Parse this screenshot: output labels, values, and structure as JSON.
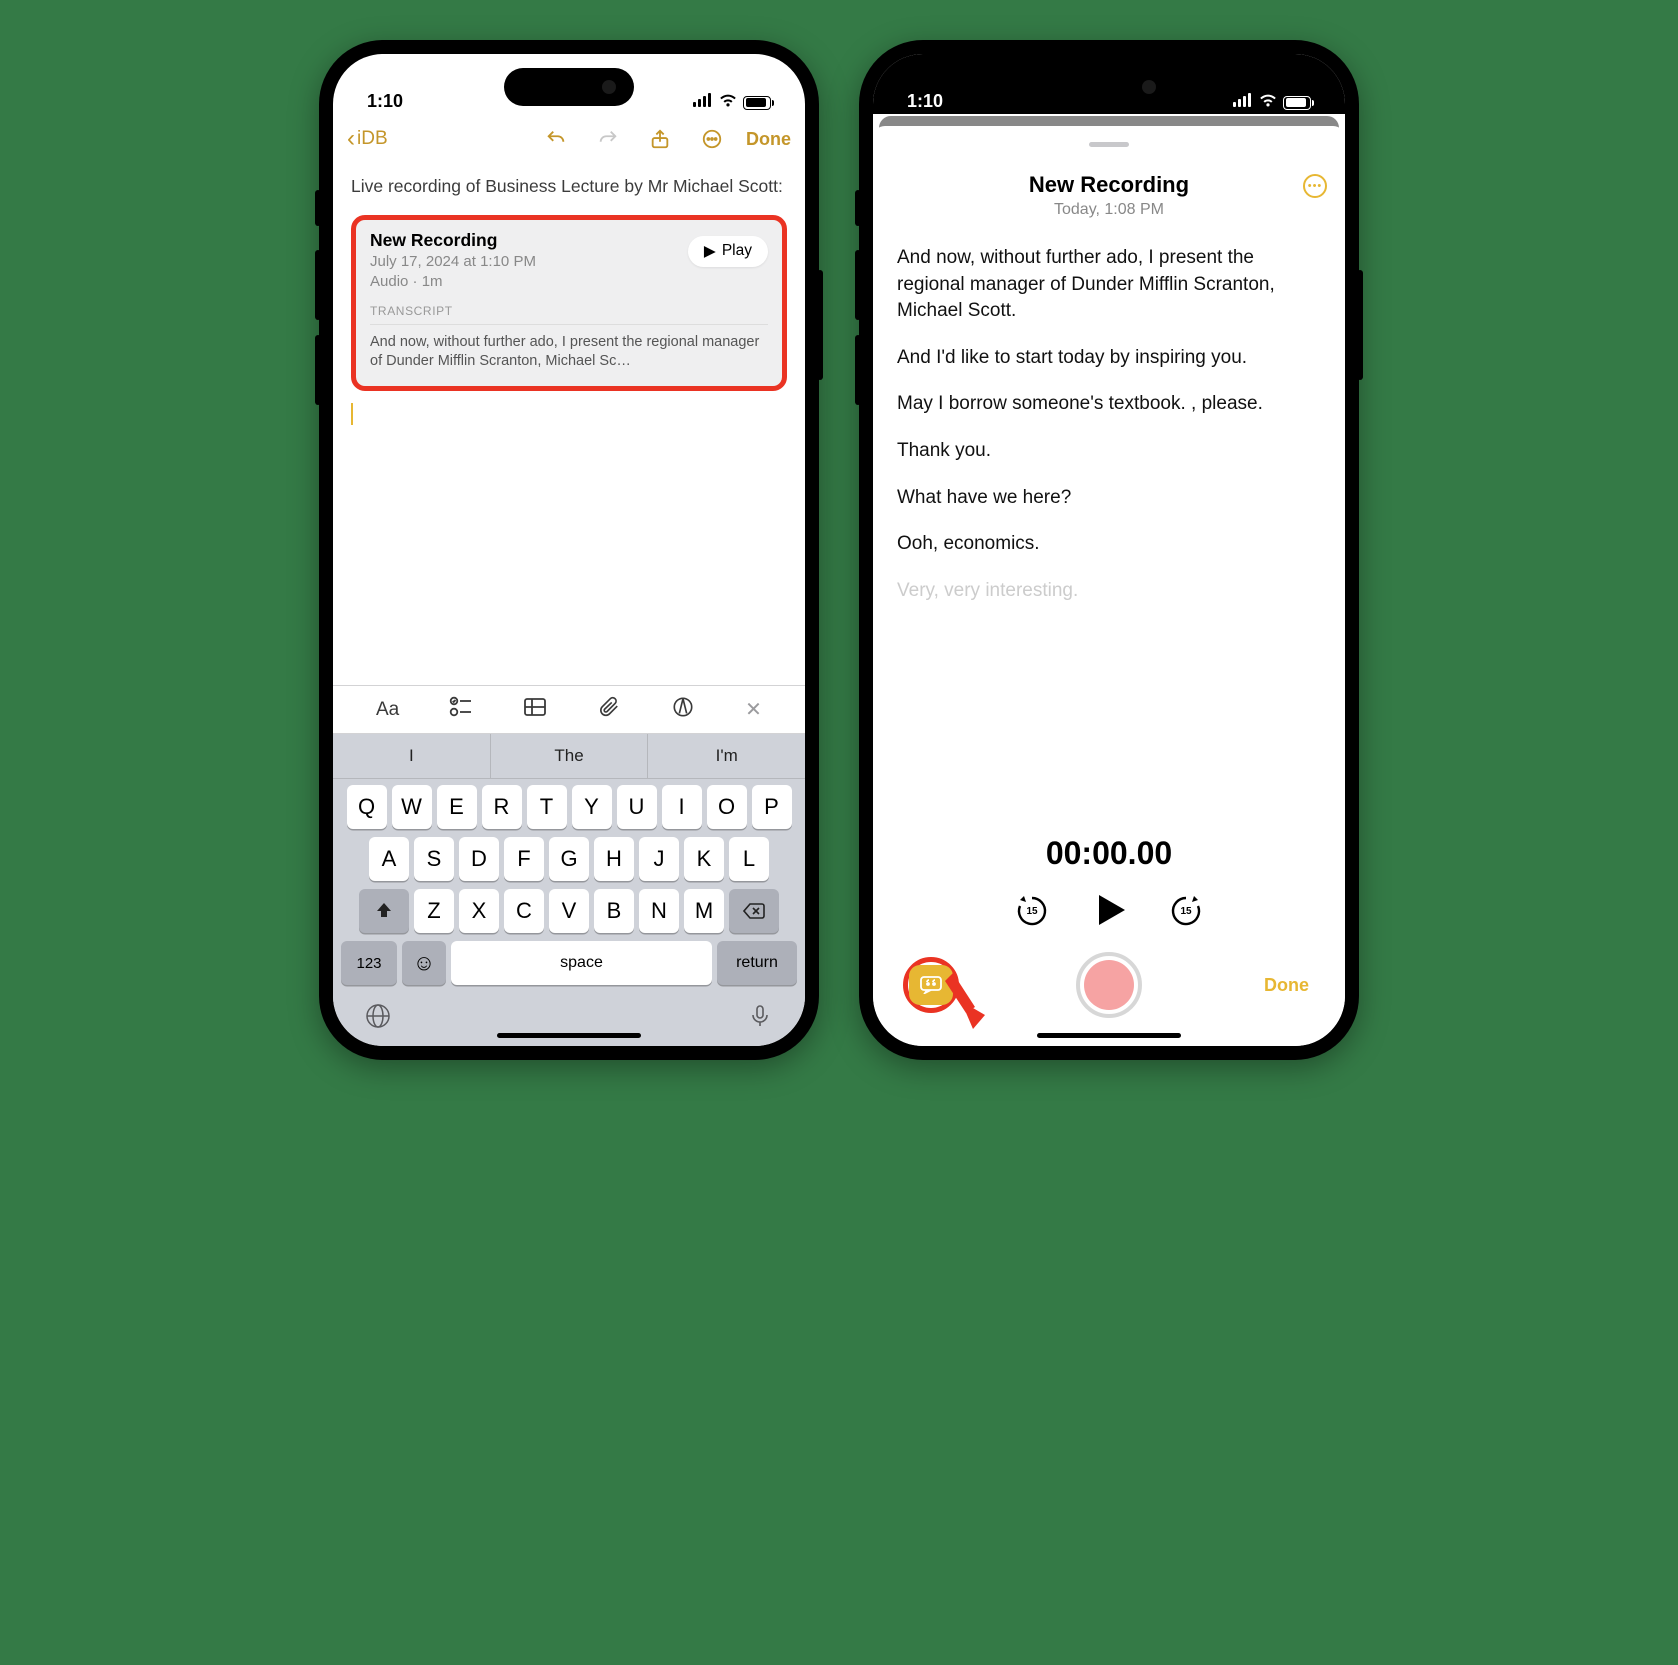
{
  "status": {
    "time": "1:10"
  },
  "left": {
    "toolbar": {
      "back": "iDB",
      "done": "Done"
    },
    "note": {
      "text": "Live recording of Business Lecture by Mr Michael Scott:"
    },
    "recording": {
      "title": "New Recording",
      "date": "July 17, 2024 at 1:10 PM",
      "meta": "Audio · 1m",
      "play": "Play",
      "transcript_label": "TRANSCRIPT",
      "snippet": "And now, without further ado, I present the regional manager of Dunder Mifflin Scranton, Michael Sc…"
    },
    "format_bar": {
      "aa": "Aa"
    },
    "suggestions": [
      "I",
      "The",
      "I'm"
    ],
    "keyboard": {
      "row1": [
        "Q",
        "W",
        "E",
        "R",
        "T",
        "Y",
        "U",
        "I",
        "O",
        "P"
      ],
      "row2": [
        "A",
        "S",
        "D",
        "F",
        "G",
        "H",
        "J",
        "K",
        "L"
      ],
      "row3": [
        "Z",
        "X",
        "C",
        "V",
        "B",
        "N",
        "M"
      ],
      "numkey": "123",
      "space": "space",
      "return": "return"
    }
  },
  "right": {
    "header": {
      "title": "New Recording",
      "sub": "Today, 1:08 PM"
    },
    "transcript": [
      "And now, without further ado, I present the regional manager of Dunder Mifflin Scranton, Michael Scott.",
      "And I'd like to start today by inspiring you.",
      "May I borrow someone's textbook. , please.",
      "Thank you.",
      "What have we here?",
      "Ooh, economics."
    ],
    "transcript_fade": "Very, very interesting.",
    "timer": "00:00.00",
    "skip_amount": "15",
    "done": "Done"
  }
}
